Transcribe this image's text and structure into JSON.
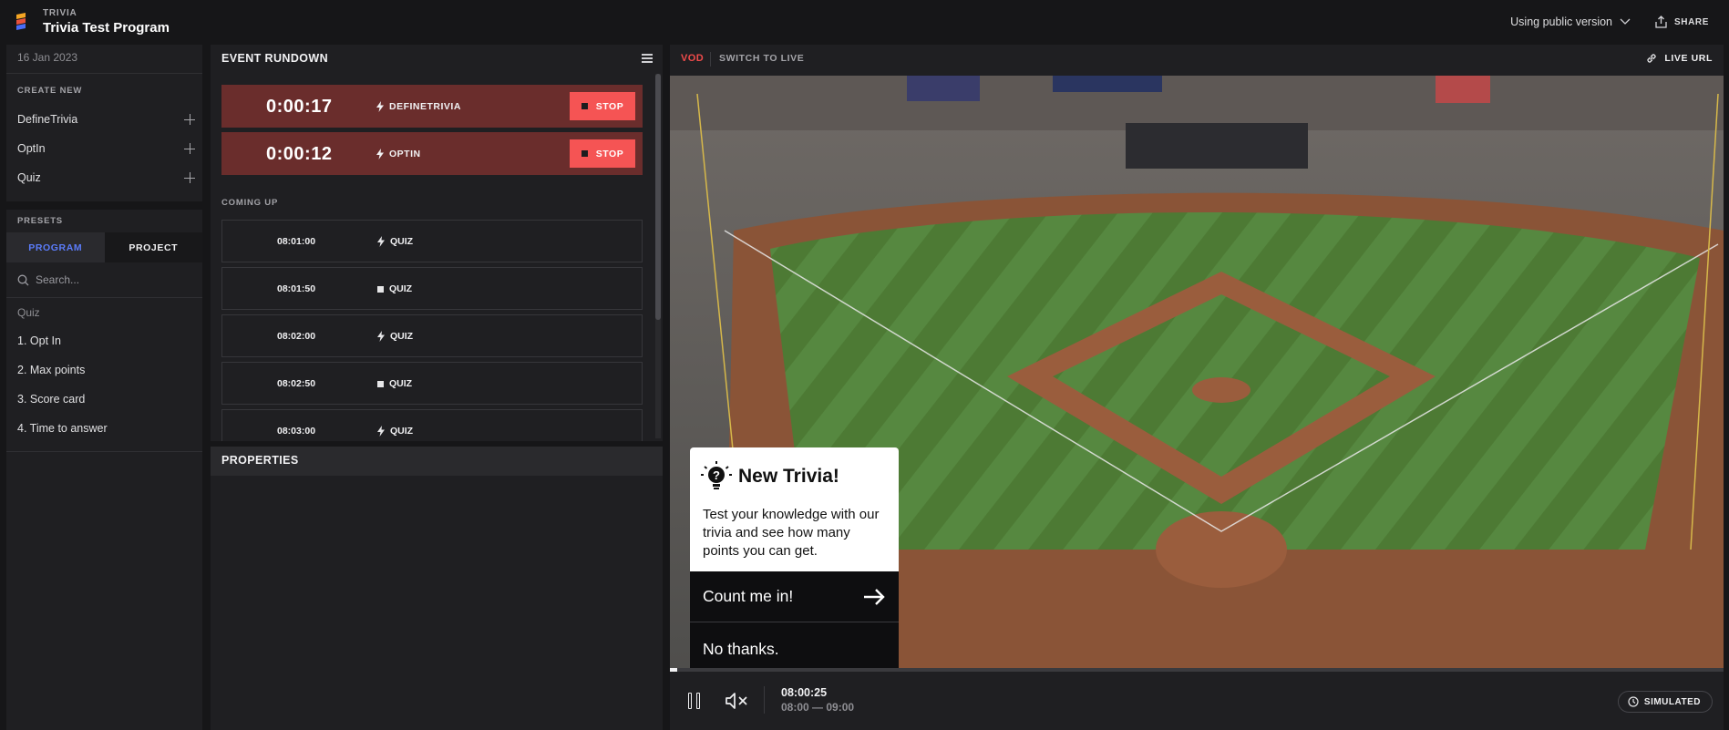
{
  "app": {
    "kicker": "TRIVIA",
    "title": "Trivia Test Program"
  },
  "header": {
    "version_label": "Using public version",
    "share_label": "SHARE"
  },
  "left_panel": {
    "date": "16 Jan 2023",
    "create_new_label": "CREATE NEW",
    "create_items": [
      {
        "label": "DefineTrivia"
      },
      {
        "label": "OptIn"
      },
      {
        "label": "Quiz"
      }
    ],
    "presets_label": "PRESETS",
    "tabs": [
      {
        "label": "PROGRAM",
        "active": true
      },
      {
        "label": "PROJECT",
        "active": false
      }
    ],
    "search_placeholder": "Search...",
    "group_label": "Quiz",
    "presets": [
      {
        "label": "1. Opt In"
      },
      {
        "label": "2. Max points"
      },
      {
        "label": "3. Score card"
      },
      {
        "label": "4. Time to answer"
      }
    ]
  },
  "rundown": {
    "title": "EVENT RUNDOWN",
    "live_events": [
      {
        "time": "0:00:17",
        "type": "DEFINETRIVIA",
        "stop_label": "STOP"
      },
      {
        "time": "0:00:12",
        "type": "OPTIN",
        "stop_label": "STOP"
      }
    ],
    "coming_up_label": "COMING UP",
    "upcoming": [
      {
        "time": "08:01:00",
        "type": "QUIZ",
        "icon": "bolt-icon"
      },
      {
        "time": "08:01:50",
        "type": "QUIZ",
        "icon": "square-icon"
      },
      {
        "time": "08:02:00",
        "type": "QUIZ",
        "icon": "bolt-icon"
      },
      {
        "time": "08:02:50",
        "type": "QUIZ",
        "icon": "square-icon"
      },
      {
        "time": "08:03:00",
        "type": "QUIZ",
        "icon": "bolt-icon"
      }
    ]
  },
  "properties": {
    "title": "PROPERTIES"
  },
  "video": {
    "mode": "VOD",
    "switch_label": "SWITCH TO LIVE",
    "live_url_label": "LIVE URL",
    "current_time": "08:00:25",
    "time_range": "08:00 — 09:00",
    "simulated_label": "SIMULATED",
    "progress_fraction": 0.007,
    "trivia": {
      "title": "New Trivia!",
      "text": "Test your knowledge with our trivia and see how many points you can get.",
      "accept_label": "Count me in!",
      "decline_label": "No thanks."
    }
  },
  "colors": {
    "accent_blue": "#5b7cfa",
    "stop_red": "#f55454",
    "live_card": "#6a2d2c",
    "vod_red": "#f04b4b"
  }
}
